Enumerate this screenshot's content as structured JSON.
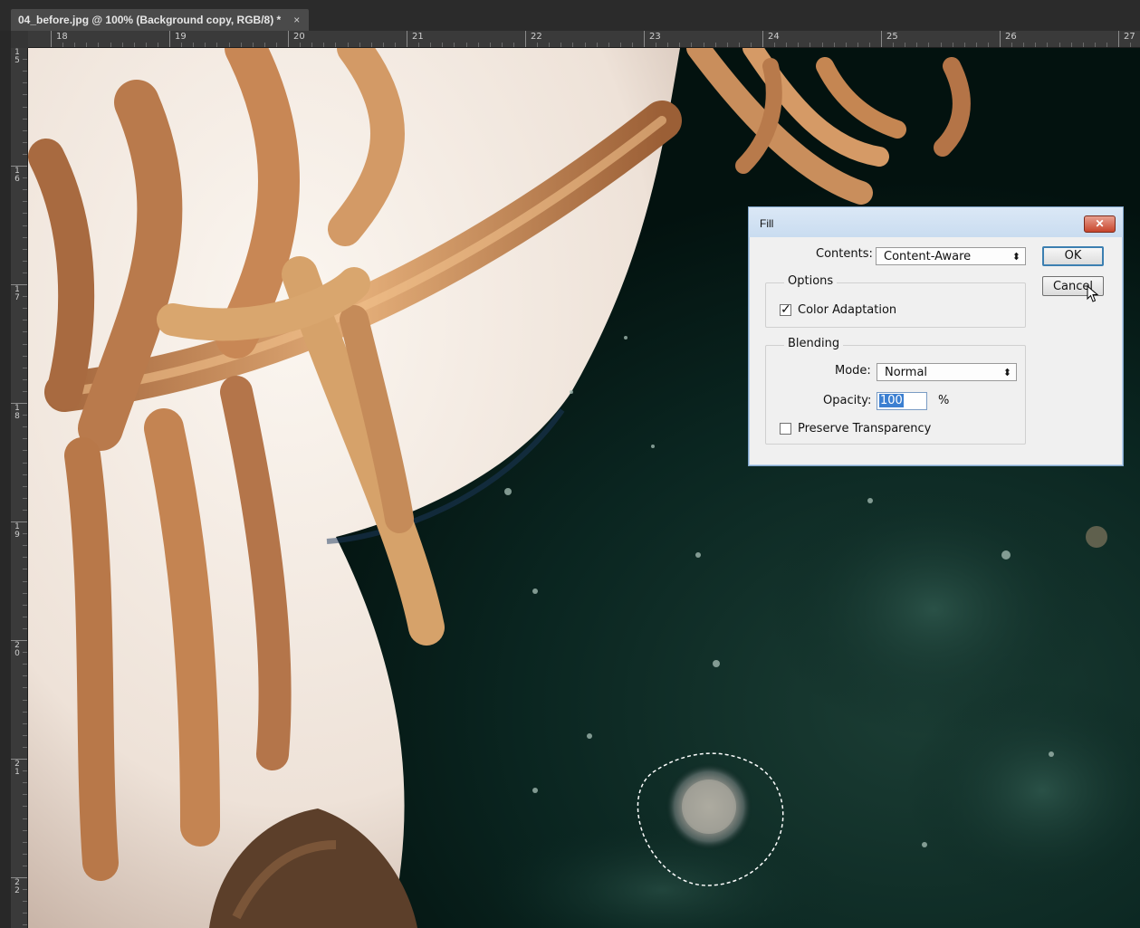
{
  "document": {
    "tab_title": "04_before.jpg @ 100% (Background copy, RGB/8) *",
    "close_glyph": "×"
  },
  "ruler": {
    "horizontal_labels": [
      "18",
      "19",
      "20",
      "21",
      "22",
      "23",
      "24",
      "25",
      "26",
      "27"
    ],
    "vertical_labels": [
      "15",
      "16",
      "17",
      "18",
      "19",
      "20",
      "21",
      "22"
    ]
  },
  "fill_dialog": {
    "title": "Fill",
    "close_glyph": "✕",
    "contents_label": "Contents:",
    "contents_value": "Content-Aware",
    "options_legend": "Options",
    "color_adaptation_label": "Color Adaptation",
    "color_adaptation_checked": true,
    "blending_legend": "Blending",
    "mode_label": "Mode:",
    "mode_value": "Normal",
    "opacity_label": "Opacity:",
    "opacity_value": "100",
    "opacity_unit": "%",
    "preserve_transparency_label": "Preserve Transparency",
    "preserve_transparency_checked": false,
    "ok_label": "OK",
    "cancel_label": "Cancel",
    "select_arrow": "⬍",
    "checkmark_glyph": "✓"
  },
  "colors": {
    "workspace_bg": "#282828",
    "dialog_bg": "#f0f0f0",
    "title_bar": "#c9dcf0",
    "selection_highlight": "#3b7fd1"
  }
}
